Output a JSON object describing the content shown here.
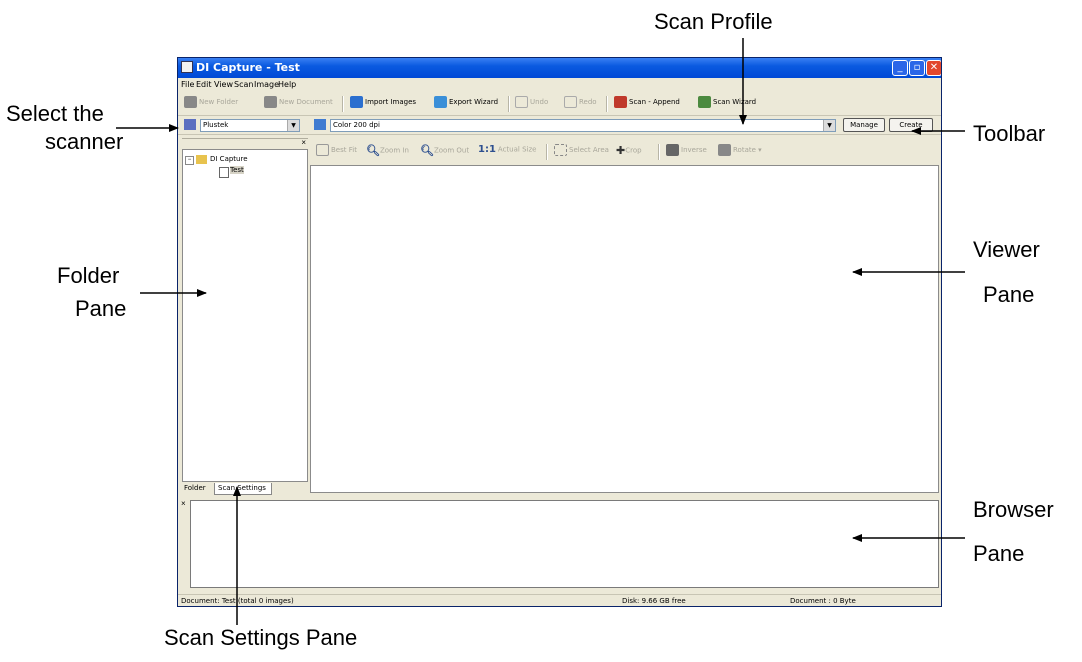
{
  "window": {
    "title": "DI Capture - Test"
  },
  "menu": [
    "File",
    "Edit",
    "View",
    "Scan",
    "Image",
    "Help"
  ],
  "toolbar": {
    "new_folder": "New Folder",
    "new_document": "New Document",
    "import_images": "Import Images",
    "export_wizard": "Export Wizard",
    "undo": "Undo",
    "redo": "Redo",
    "scan_append": "Scan - Append",
    "scan_wizard": "Scan Wizard"
  },
  "scanner_select": {
    "value": "Plustek"
  },
  "profile_select": {
    "value": "Color 200 dpi"
  },
  "buttons": {
    "manage": "Manage",
    "create": "Create"
  },
  "viewer_toolbar": {
    "best_fit": "Best Fit",
    "zoom_in": "Zoom In",
    "zoom_out": "Zoom Out",
    "actual_size_glyph": "1:1",
    "actual_size": "Actual Size",
    "select_area": "Select Area",
    "crop": "Crop",
    "inverse": "Inverse",
    "rotate": "Rotate"
  },
  "tree": {
    "root": "DI Capture",
    "child": "Test"
  },
  "tabs": {
    "folder": "Folder",
    "scan_settings": "Scan Settings"
  },
  "status": {
    "document": "Document: Test (total 0 images)",
    "disk": "Disk: 9.66 GB free",
    "doc_size": "Document : 0 Byte"
  },
  "callouts": {
    "scan_profile": "Scan Profile",
    "select_scanner_line1": "Select the",
    "select_scanner_line2": "scanner",
    "toolbar": "Toolbar",
    "viewer_line1": "Viewer",
    "viewer_line2": "Pane",
    "folder_line1": "Folder",
    "folder_line2": "Pane",
    "browser_line1": "Browser",
    "browser_line2": "Pane",
    "scan_settings_pane": "Scan Settings Pane"
  },
  "colors": {
    "titlebar": "#0a5ae0",
    "window_bg": "#ece9d8",
    "close_button": "#e2472c"
  }
}
